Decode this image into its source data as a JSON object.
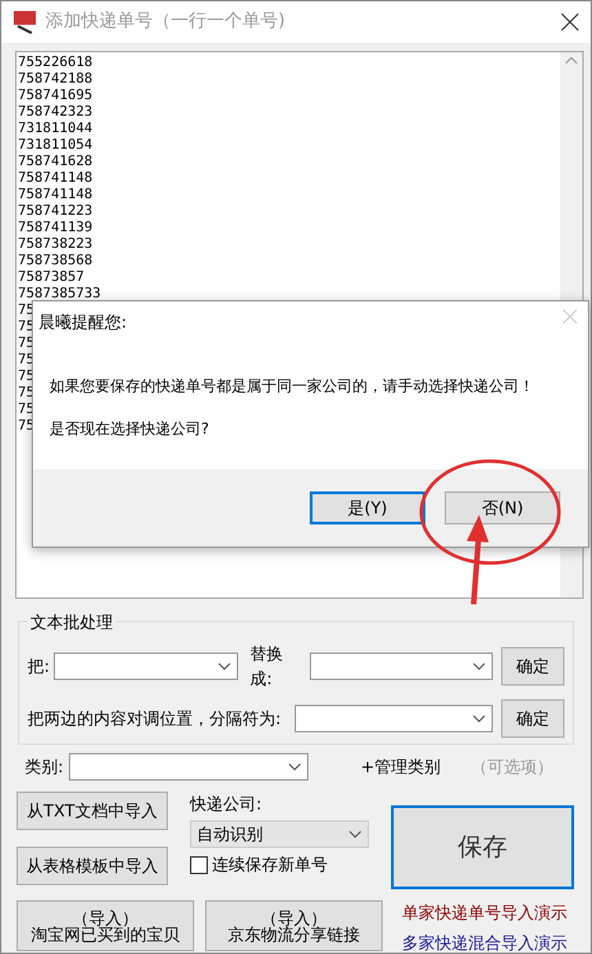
{
  "window": {
    "title": "添加快递单号（一行一个单号)"
  },
  "tracking_list": {
    "lines": [
      "755226618",
      "758742188",
      "758741695",
      "758742323",
      "731811044",
      "731811054",
      "758741628",
      "758741148",
      "758741148",
      "758741223",
      "758741139",
      "758738223",
      "758738568",
      "75873857",
      "7587385733",
      "75",
      "75",
      "75",
      "75",
      "75",
      "75",
      "75",
      "75"
    ]
  },
  "batch": {
    "title": "文本批处理",
    "replace_label": "把:",
    "replace_with_label": "替换成:",
    "swap_label": "把两边的内容对调位置，分隔符为:",
    "confirm_buttons": [
      "确定",
      "确定"
    ]
  },
  "category": {
    "label": "类别:",
    "manage_link": "+管理类别",
    "note": "（可选项）"
  },
  "import_buttons": [
    "从TXT文档中导入",
    "从表格模板中导入"
  ],
  "courier": {
    "label": "快递公司:",
    "value": "自动识别"
  },
  "continuous_save": {
    "label": "连续保存新单号",
    "checked": false
  },
  "save_button": "保存",
  "share_buttons": [
    {
      "lines": [
        "（导入）",
        "淘宝网已买到的宝贝"
      ]
    },
    {
      "lines": [
        "（导入）",
        "京东物流分享链接"
      ]
    }
  ],
  "demo_links": [
    {
      "text": "单家快递单号导入演示",
      "color": "#8b0000"
    },
    {
      "text": "多家快递混合导入演示",
      "color": "#1a1a9c"
    }
  ],
  "dialog": {
    "title": "晨曦提醒您:",
    "messages": [
      "如果您要保存的快递单号都是属于同一家公司的，请手动选择快递公司！",
      "是否现在选择快递公司?"
    ],
    "buttons": [
      {
        "label": "是(Y)",
        "selected": true
      },
      {
        "label": "否(N)",
        "selected": false
      }
    ]
  }
}
